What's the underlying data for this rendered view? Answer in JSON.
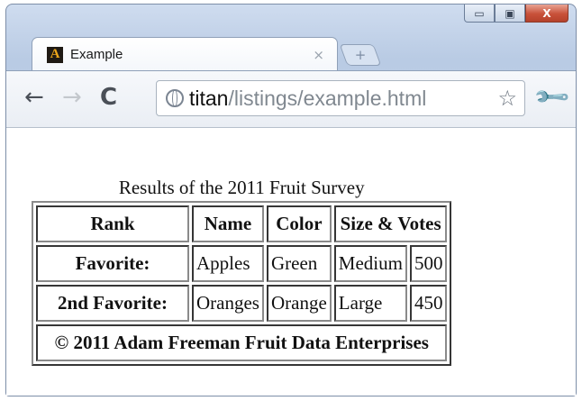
{
  "browser": {
    "tab_title": "Example",
    "tab_close": "×",
    "new_tab": "+",
    "url_host": "titan",
    "url_path": "/listings/example.html"
  },
  "icons": {
    "back": "arrow-left",
    "forward": "arrow-right",
    "reload": "reload",
    "globe": "globe",
    "bookmark": "star",
    "menu": "wrench"
  },
  "window_controls": {
    "minimize": "▭",
    "maximize": "▣",
    "close": "X"
  },
  "table": {
    "caption": "Results of the 2011 Fruit Survey",
    "headers": {
      "rank": "Rank",
      "name": "Name",
      "color": "Color",
      "size_votes": "Size & Votes"
    },
    "rows": [
      {
        "rank": "Favorite:",
        "name": "Apples",
        "color": "Green",
        "size": "Medium",
        "votes": "500"
      },
      {
        "rank": "2nd Favorite:",
        "name": "Oranges",
        "color": "Orange",
        "size": "Large",
        "votes": "450"
      }
    ],
    "footer": "© 2011 Adam Freeman Fruit Data Enterprises"
  }
}
